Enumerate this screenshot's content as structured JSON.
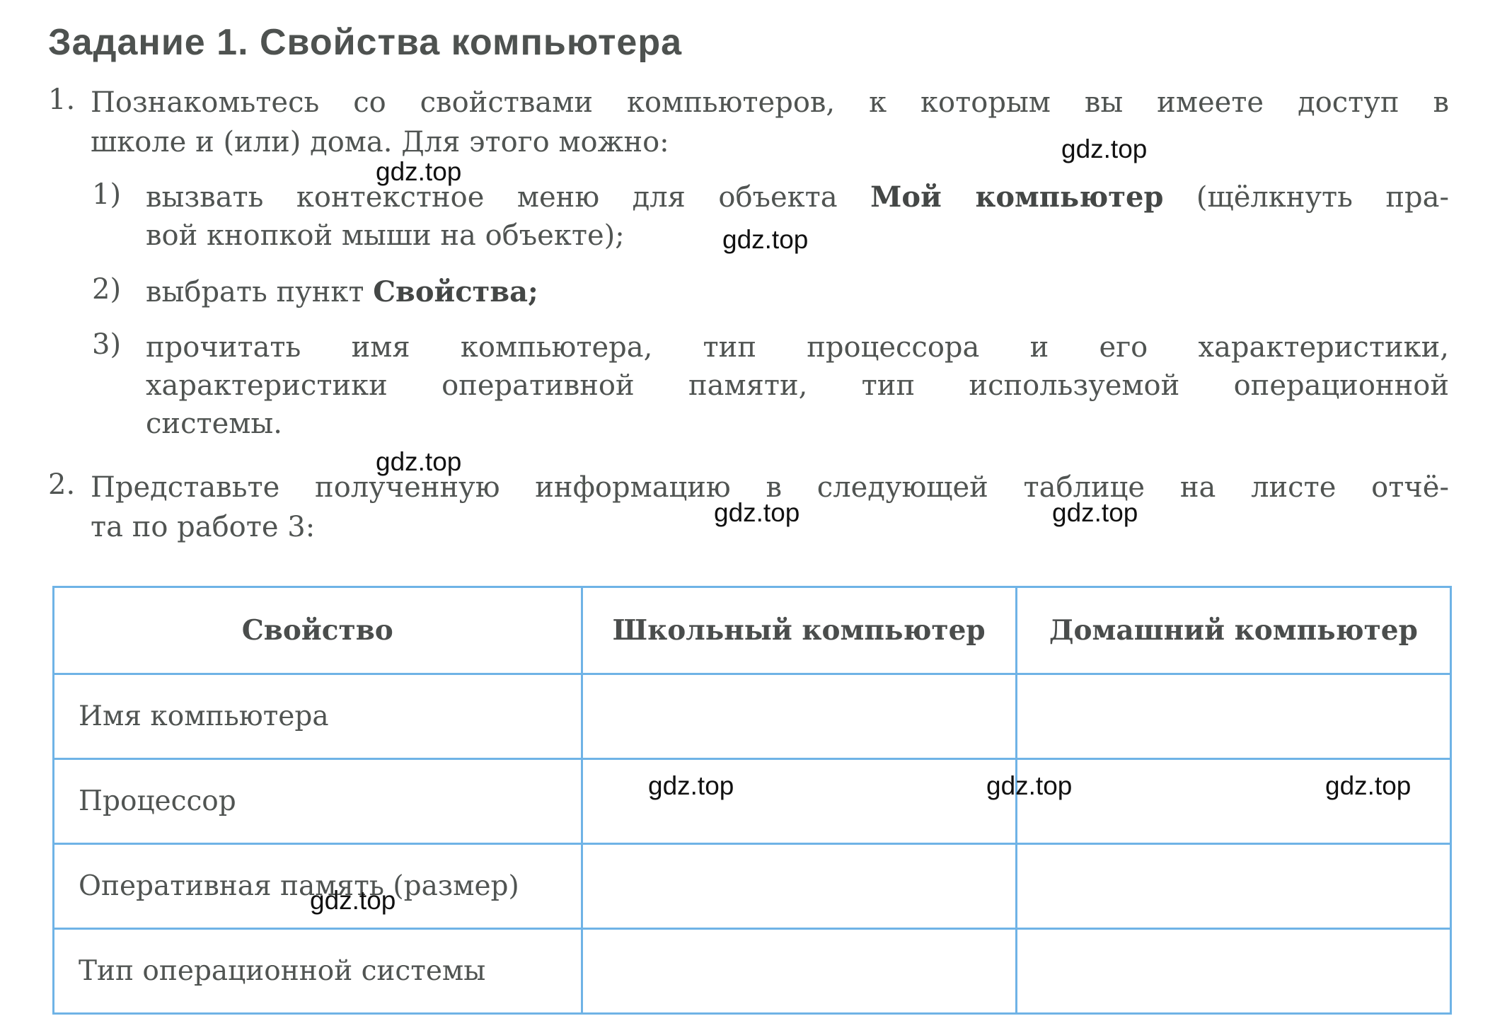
{
  "title": "Задание 1. Свойства компьютера",
  "task1": {
    "number": "1.",
    "line1": "Познакомьтесь со свойствами компьютеров, к которым вы имеете доступ в",
    "line2": "школе и (или) дома. Для этого можно:",
    "steps": [
      {
        "number": "1)",
        "line1_pre": "вызвать контекстное меню для объекта",
        "line1_bold": "Мой компьютер",
        "line1_post": "(щёлкнуть пра-",
        "line2": "вой кнопкой мыши на объекте);"
      },
      {
        "number": "2)",
        "pre": "выбрать пункт",
        "bold": "Свойства",
        "post": ";"
      },
      {
        "number": "3)",
        "line1": "прочитать имя компьютера, тип процессора и его характеристики,",
        "line2": "характеристики оперативной памяти, тип используемой операционной",
        "line3": "системы."
      }
    ]
  },
  "task2": {
    "number": "2.",
    "line1": "Представьте полученную информацию в следующей таблице на листе отчё-",
    "line2": "та по работе 3:"
  },
  "table": {
    "headers": [
      "Свойство",
      "Школьный компьютер",
      "Домашний компьютер"
    ],
    "rows": [
      [
        "Имя компьютера",
        "",
        ""
      ],
      [
        "Процессор",
        "",
        ""
      ],
      [
        "Оперативная память (размер)",
        "",
        ""
      ],
      [
        "Тип операционной системы",
        "",
        ""
      ]
    ]
  },
  "watermark": "gdz.top"
}
